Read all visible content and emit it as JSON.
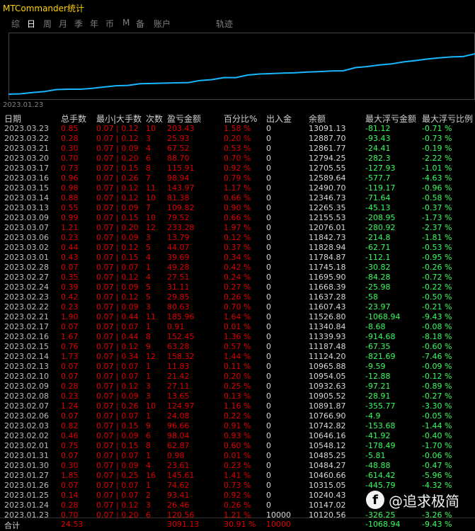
{
  "app": {
    "title": "MTCommander统计"
  },
  "tabs": [
    {
      "label": "综"
    },
    {
      "label": "日"
    },
    {
      "label": "周"
    },
    {
      "label": "月"
    },
    {
      "label": "季"
    },
    {
      "label": "年"
    },
    {
      "label": "币"
    },
    {
      "label": "M"
    },
    {
      "label": "备"
    },
    {
      "label": "账户"
    },
    {
      "label": "轨迹"
    }
  ],
  "chart": {
    "x_start_label": "2023.01.23",
    "line_color": "#18b7ff"
  },
  "table": {
    "headers": [
      "日期",
      "总手数",
      "最小|大手数",
      "次数",
      "盈亏金额",
      "百分比%",
      "出入金",
      "余额",
      "最大浮亏金额",
      "最大浮亏比例"
    ],
    "rows": [
      [
        "2023.03.23",
        "0.85",
        "0.07 | 0.12",
        "10",
        "203.43",
        "1.58 %",
        "0",
        "13091.13",
        "-81.12",
        "-0.71 %"
      ],
      [
        "2023.03.22",
        "0.28",
        "0.07 | 0.12",
        "3",
        "25.93",
        "0.20 %",
        "0",
        "12887.70",
        "-93.43",
        "-0.73 %"
      ],
      [
        "2023.03.21",
        "0.30",
        "0.07 | 0.09",
        "4",
        "67.52",
        "0.53 %",
        "0",
        "12861.77",
        "-24.41",
        "-0.19 %"
      ],
      [
        "2023.03.20",
        "0.70",
        "0.07 | 0.20",
        "6",
        "88.70",
        "0.70 %",
        "0",
        "12794.25",
        "-282.3",
        "-2.22 %"
      ],
      [
        "2023.03.17",
        "0.73",
        "0.07 | 0.15",
        "8",
        "115.91",
        "0.92 %",
        "0",
        "12705.55",
        "-127.93",
        "-1.01 %"
      ],
      [
        "2023.03.16",
        "0.96",
        "0.07 | 0.26",
        "7",
        "98.94",
        "0.79 %",
        "0",
        "12589.64",
        "-577.7",
        "-4.63 %"
      ],
      [
        "2023.03.15",
        "0.98",
        "0.07 | 0.12",
        "11",
        "143.97",
        "1.17 %",
        "0",
        "12490.70",
        "-119.17",
        "-0.96 %"
      ],
      [
        "2023.03.14",
        "0.88",
        "0.07 | 0.12",
        "10",
        "81.38",
        "0.66 %",
        "0",
        "12346.73",
        "-71.64",
        "-0.58 %"
      ],
      [
        "2023.03.13",
        "0.55",
        "0.07 | 0.09",
        "7",
        "109.82",
        "0.90 %",
        "0",
        "12265.35",
        "-45.13",
        "-0.37 %"
      ],
      [
        "2023.03.09",
        "0.99",
        "0.07 | 0.15",
        "10",
        "79.52",
        "0.66 %",
        "0",
        "12155.53",
        "-208.95",
        "-1.73 %"
      ],
      [
        "2023.03.07",
        "1.21",
        "0.07 | 0.20",
        "12",
        "233.28",
        "1.97 %",
        "0",
        "12076.01",
        "-280.92",
        "-2.37 %"
      ],
      [
        "2023.03.06",
        "0.23",
        "0.07 | 0.09",
        "3",
        "13.79",
        "0.12 %",
        "0",
        "11842.73",
        "-214.8",
        "-1.81 %"
      ],
      [
        "2023.03.02",
        "0.44",
        "0.07 | 0.12",
        "5",
        "44.07",
        "0.37 %",
        "0",
        "11828.94",
        "-62.71",
        "-0.53 %"
      ],
      [
        "2023.03.01",
        "0.43",
        "0.07 | 0.15",
        "4",
        "39.69",
        "0.34 %",
        "0",
        "11784.87",
        "-112.1",
        "-0.95 %"
      ],
      [
        "2023.02.28",
        "0.07",
        "0.07 | 0.07",
        "1",
        "49.28",
        "0.42 %",
        "0",
        "11745.18",
        "-30.82",
        "-0.26 %"
      ],
      [
        "2023.02.27",
        "0.35",
        "0.07 | 0.12",
        "4",
        "27.51",
        "0.24 %",
        "0",
        "11695.90",
        "-84.28",
        "-0.72 %"
      ],
      [
        "2023.02.24",
        "0.39",
        "0.07 | 0.09",
        "5",
        "31.11",
        "0.27 %",
        "0",
        "11668.39",
        "-25.98",
        "-0.22 %"
      ],
      [
        "2023.02.23",
        "0.42",
        "0.07 | 0.12",
        "5",
        "29.85",
        "0.26 %",
        "0",
        "11637.28",
        "-58",
        "-0.50 %"
      ],
      [
        "2023.02.22",
        "0.23",
        "0.07 | 0.09",
        "3",
        "80.63",
        "0.70 %",
        "0",
        "11607.43",
        "-23.97",
        "-0.21 %"
      ],
      [
        "2023.02.21",
        "1.90",
        "0.07 | 0.44",
        "11",
        "185.96",
        "1.64 %",
        "0",
        "11526.80",
        "-1068.94",
        "-9.43 %"
      ],
      [
        "2023.02.17",
        "0.07",
        "0.07 | 0.07",
        "1",
        "0.91",
        "0.01 %",
        "0",
        "11340.84",
        "-8.68",
        "-0.08 %"
      ],
      [
        "2023.02.16",
        "1.67",
        "0.07 | 0.44",
        "8",
        "152.45",
        "1.36 %",
        "0",
        "11339.93",
        "-914.68",
        "-8.18 %"
      ],
      [
        "2023.02.15",
        "0.76",
        "0.07 | 0.12",
        "9",
        "63.28",
        "0.57 %",
        "0",
        "11187.48",
        "-67.35",
        "-0.60 %"
      ],
      [
        "2023.02.14",
        "1.73",
        "0.07 | 0.34",
        "12",
        "158.32",
        "1.44 %",
        "0",
        "11124.20",
        "-821.69",
        "-7.46 %"
      ],
      [
        "2023.02.13",
        "0.07",
        "0.07 | 0.07",
        "1",
        "11.83",
        "0.11 %",
        "0",
        "10965.88",
        "-9.59",
        "-0.09 %"
      ],
      [
        "2023.02.10",
        "0.07",
        "0.07 | 0.07",
        "1",
        "21.42",
        "0.20 %",
        "0",
        "10954.05",
        "-12.88",
        "-0.12 %"
      ],
      [
        "2023.02.09",
        "0.28",
        "0.07 | 0.12",
        "3",
        "27.11",
        "0.25 %",
        "0",
        "10932.63",
        "-97.21",
        "-0.89 %"
      ],
      [
        "2023.02.08",
        "0.23",
        "0.07 | 0.09",
        "3",
        "13.65",
        "0.13 %",
        "0",
        "10905.52",
        "-28.91",
        "-0.27 %"
      ],
      [
        "2023.02.07",
        "1.24",
        "0.07 | 0.26",
        "10",
        "124.97",
        "1.16 %",
        "0",
        "10891.87",
        "-355.77",
        "-3.30 %"
      ],
      [
        "2023.02.06",
        "0.07",
        "0.07 | 0.07",
        "1",
        "24.08",
        "0.22 %",
        "0",
        "10766.90",
        "-4.9",
        "-0.05 %"
      ],
      [
        "2023.02.03",
        "0.82",
        "0.07 | 0.15",
        "9",
        "96.66",
        "0.91 %",
        "0",
        "10742.82",
        "-153.68",
        "-1.44 %"
      ],
      [
        "2023.02.02",
        "0.46",
        "0.07 | 0.09",
        "6",
        "98.04",
        "0.93 %",
        "0",
        "10646.16",
        "-41.92",
        "-0.40 %"
      ],
      [
        "2023.02.01",
        "0.75",
        "0.07 | 0.15",
        "8",
        "62.87",
        "0.60 %",
        "0",
        "10548.12",
        "-178.49",
        "-1.70 %"
      ],
      [
        "2023.01.31",
        "0.07",
        "0.07 | 0.07",
        "1",
        "0.98",
        "0.01 %",
        "0",
        "10485.25",
        "-5.81",
        "-0.06 %"
      ],
      [
        "2023.01.30",
        "0.30",
        "0.07 | 0.09",
        "4",
        "23.61",
        "0.23 %",
        "0",
        "10484.27",
        "-48.88",
        "-0.47 %"
      ],
      [
        "2023.01.27",
        "1.85",
        "0.07 | 0.25",
        "16",
        "145.61",
        "1.41 %",
        "0",
        "10460.66",
        "-614.42",
        "-5.96 %"
      ],
      [
        "2023.01.26",
        "0.07",
        "0.07 | 0.07",
        "1",
        "74.62",
        "0.73 %",
        "0",
        "10315.05",
        "-445.79",
        "-4.32 %"
      ],
      [
        "2023.01.25",
        "0.14",
        "0.07 | 0.07",
        "2",
        "93.41",
        "0.92 %",
        "0",
        "10240.43",
        "",
        "-"
      ],
      [
        "2023.01.24",
        "0.28",
        "0.07 | 0.12",
        "3",
        "26.46",
        "0.26 %",
        "0",
        "10147.02",
        "",
        "-"
      ],
      [
        "2023.01.23",
        "0.70",
        "0.07 | 0.20",
        "6",
        "120.56",
        "1.21 %",
        "10000",
        "10120.56",
        "-326.25",
        "-3.26 %"
      ]
    ],
    "total": [
      "合计",
      "24.53",
      "",
      "",
      "3091.13",
      "30.91 %",
      "10000",
      "",
      "-1068.94",
      "-9.43 %"
    ]
  },
  "watermark": {
    "text": "@追求极简"
  }
}
